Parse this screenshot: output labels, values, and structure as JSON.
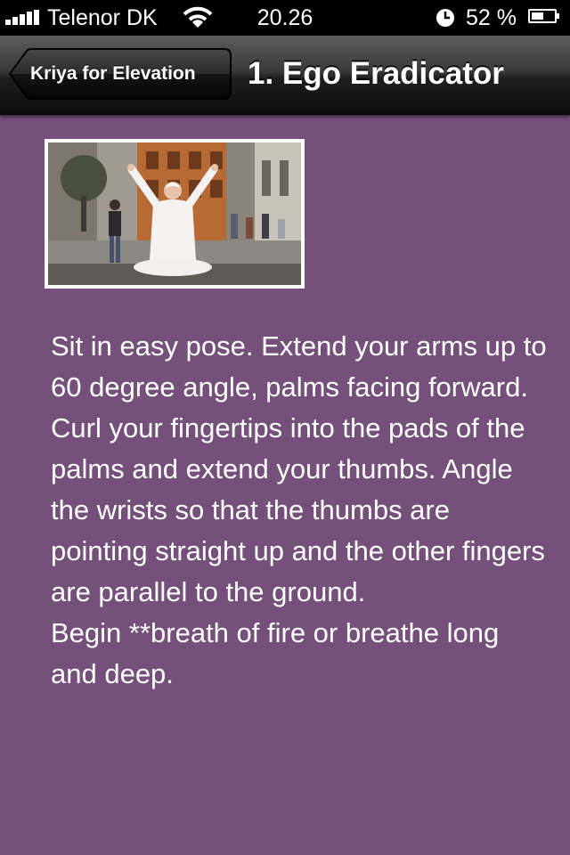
{
  "status_bar": {
    "carrier": "Telenor DK",
    "time": "20.26",
    "battery": "52 %",
    "battery_level": 0.52,
    "icons": [
      "signal-icon",
      "wifi-icon",
      "clock-icon",
      "battery-icon"
    ]
  },
  "nav": {
    "back_label": "Kriya for Elevation",
    "title": "1. Ego Eradicator"
  },
  "instructions": "Sit in easy pose. Extend your arms up to 60 degree angle, palms facing forward. Curl your fingertips into the pads of the palms and extend your thumbs. Angle the wrists so that the thumbs are pointing straight up and the other fingers are parallel to the ground.\nBegin **breath of fire or breathe long and deep.",
  "colors": {
    "background": "#75507b",
    "navbar": "#1e1e1e",
    "text": "#ffffff"
  }
}
